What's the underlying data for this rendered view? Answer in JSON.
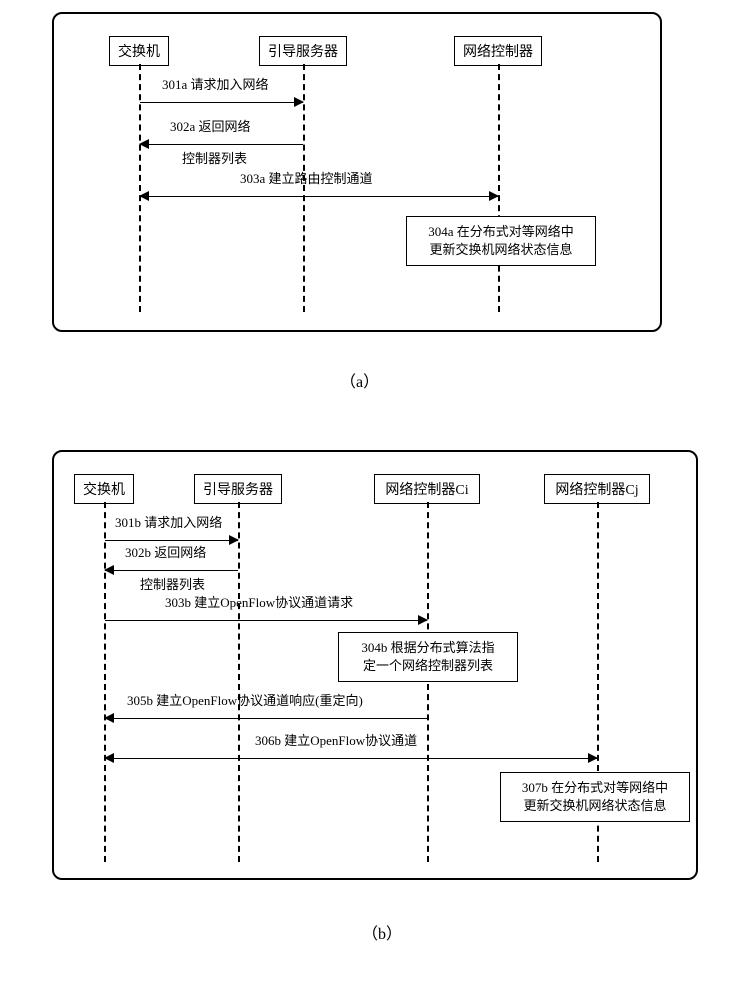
{
  "panel_a": {
    "actors": {
      "switch": "交换机",
      "boot_server": "引导服务器",
      "controller": "网络控制器"
    },
    "messages": {
      "m1": "301a 请求加入网络",
      "m2_line1": "302a 返回网络",
      "m2_line2": "控制器列表",
      "m3": "303a 建立路由控制通道"
    },
    "note_line1": "304a 在分布式对等网络中",
    "note_line2": "更新交换机网络状态信息",
    "label": "（a）"
  },
  "panel_b": {
    "actors": {
      "switch": "交换机",
      "boot_server": "引导服务器",
      "controller_ci": "网络控制器Ci",
      "controller_cj": "网络控制器Cj"
    },
    "messages": {
      "m1": "301b 请求加入网络",
      "m2_line1": "302b 返回网络",
      "m2_line2": "控制器列表",
      "m3": "303b 建立OpenFlow协议通道请求",
      "m5": "305b 建立OpenFlow协议通道响应(重定向)",
      "m6": "306b 建立OpenFlow协议通道"
    },
    "note1_line1": "304b 根据分布式算法指",
    "note1_line2": "定一个网络控制器列表",
    "note2_line1": "307b 在分布式对等网络中",
    "note2_line2": "更新交换机网络状态信息",
    "label": "（b）"
  }
}
